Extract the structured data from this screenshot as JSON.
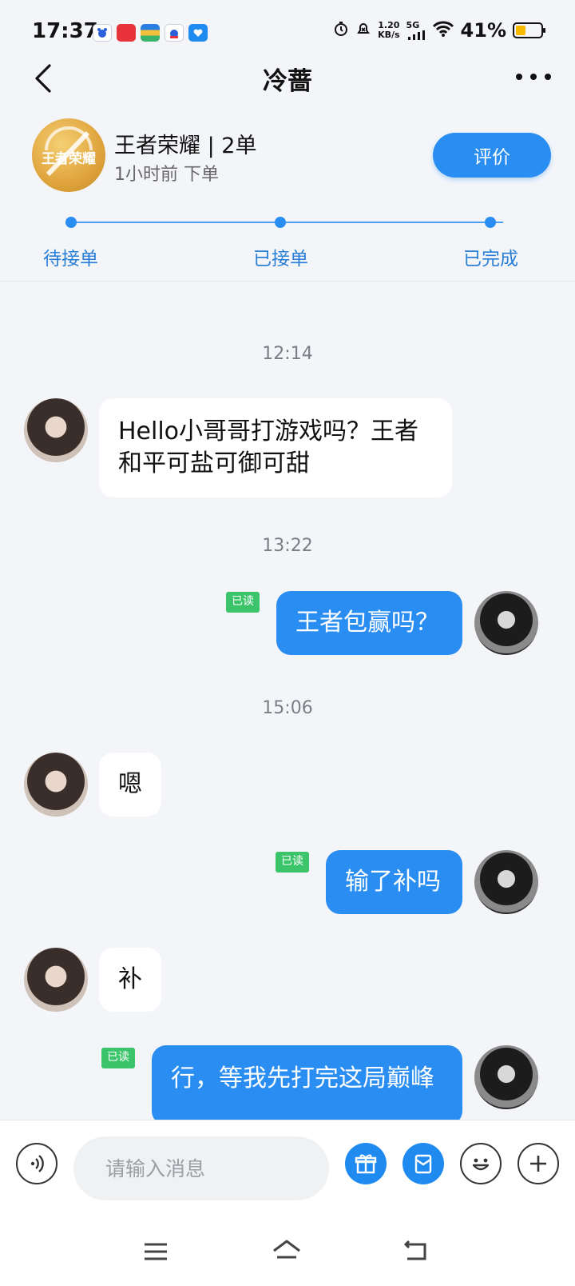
{
  "status_bar": {
    "time": "17:37",
    "network_speed_value": "1.20",
    "network_speed_unit": "KB/s",
    "network_type": "5G",
    "battery_text": "41%",
    "battery_level": 0.41,
    "battery_color": "#f6b900"
  },
  "nav": {
    "title": "冷蔷",
    "back_icon": "chevron-left-icon",
    "more_icon": "more-horizontal-icon"
  },
  "order": {
    "game_title": "王者荣耀 | 2单",
    "subtitle": "1小时前 下单",
    "logo_text": "王者荣耀",
    "rate_label": "评价",
    "steps": [
      "待接单",
      "已接单",
      "已完成"
    ],
    "accent_color": "#2a8df2"
  },
  "chat": {
    "timestamps": [
      "12:14",
      "13:22",
      "15:06"
    ],
    "read_label": "已读",
    "messages": [
      {
        "side": "in",
        "text": "Hello小哥哥打游戏吗？王者和平可盐可御可甜"
      },
      {
        "side": "out",
        "text": "王者包赢吗？",
        "read": true
      },
      {
        "side": "in",
        "text": "嗯"
      },
      {
        "side": "out",
        "text": "输了补吗",
        "read": true
      },
      {
        "side": "in",
        "text": "补"
      },
      {
        "side": "out",
        "text": "行，等我先打完这局巅峰",
        "read": true
      }
    ]
  },
  "input_bar": {
    "placeholder": "请输入消息",
    "voice_icon": "voice-icon",
    "gift_icon": "gift-icon",
    "red_packet_icon": "red-packet-icon",
    "emoji_icon": "emoji-icon",
    "plus_icon": "plus-icon"
  },
  "system_nav": {
    "menu_icon": "menu-icon",
    "home_icon": "home-icon",
    "back_icon": "back-icon"
  }
}
